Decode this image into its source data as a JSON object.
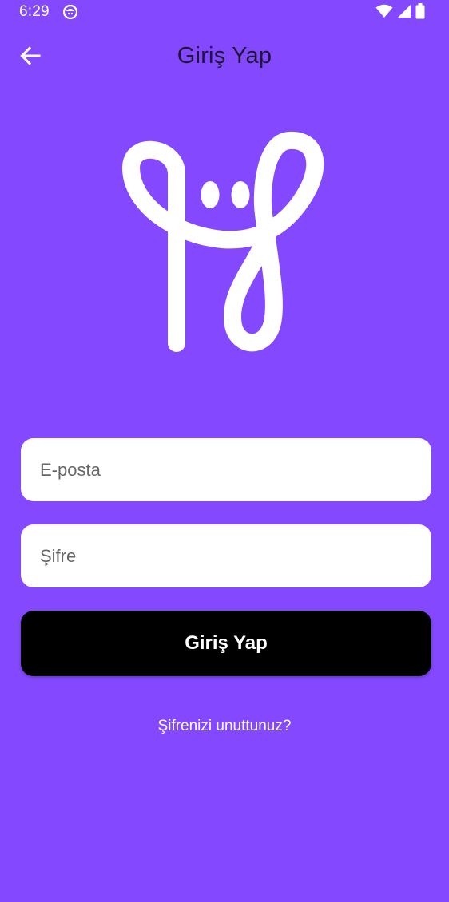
{
  "status_bar": {
    "time": "6:29",
    "app_icon": "app-notification-icon",
    "wifi_icon": "wifi-icon",
    "signal_icon": "cell-signal-icon",
    "battery_icon": "battery-icon"
  },
  "app_bar": {
    "back_icon": "arrow-left-icon",
    "title": "Giriş Yap"
  },
  "logo": {
    "icon": "app-logo-icon",
    "color": "#FFFFFF"
  },
  "form": {
    "email_placeholder": "E-posta",
    "email_value": "",
    "password_placeholder": "Şifre",
    "password_value": "",
    "login_button_label": "Giriş Yap",
    "forgot_password_label": "Şifrenizi unuttunuz?"
  },
  "colors": {
    "background": "#8449FF",
    "primary_button": "#000000",
    "field_background": "#FFFFFF",
    "title_text": "#1F1536"
  }
}
